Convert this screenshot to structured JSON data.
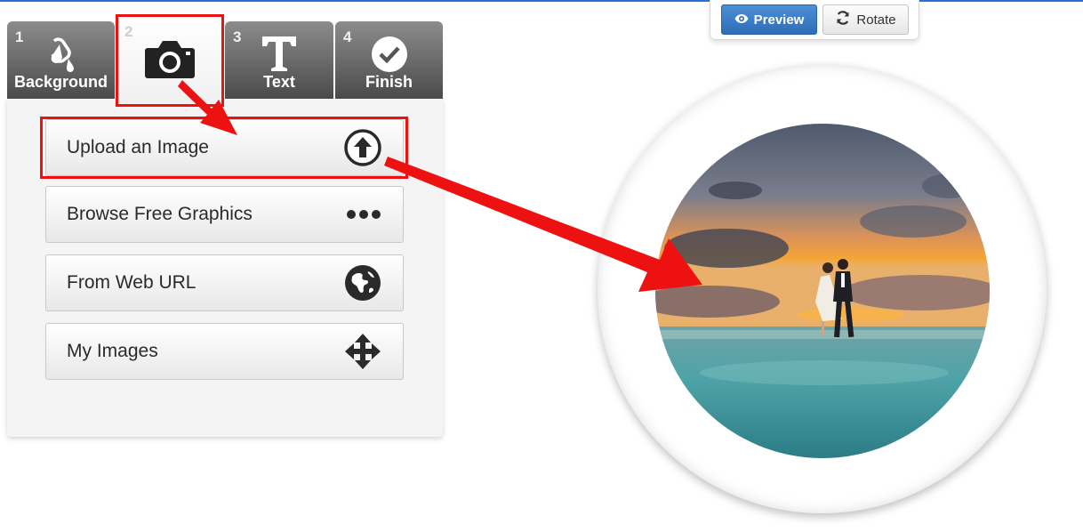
{
  "toolbar": {
    "preview_label": "Preview",
    "rotate_label": "Rotate"
  },
  "steps": [
    {
      "number": "1",
      "label": "Background",
      "icon": "paint-drop-icon"
    },
    {
      "number": "2",
      "label": "",
      "icon": "camera-icon"
    },
    {
      "number": "3",
      "label": "Text",
      "icon": "text-t-icon"
    },
    {
      "number": "4",
      "label": "Finish",
      "icon": "check-circle-icon"
    }
  ],
  "active_step": "2",
  "options": [
    {
      "label": "Upload an Image",
      "icon": "upload-arrow-icon"
    },
    {
      "label": "Browse Free Graphics",
      "icon": "ellipsis-icon"
    },
    {
      "label": "From Web URL",
      "icon": "globe-icon"
    },
    {
      "label": "My Images",
      "icon": "move-arrows-icon"
    }
  ],
  "colors": {
    "accent_blue": "#2e6db7",
    "highlight_red": "#ee1111",
    "tab_dark": "#4a4a4a"
  }
}
